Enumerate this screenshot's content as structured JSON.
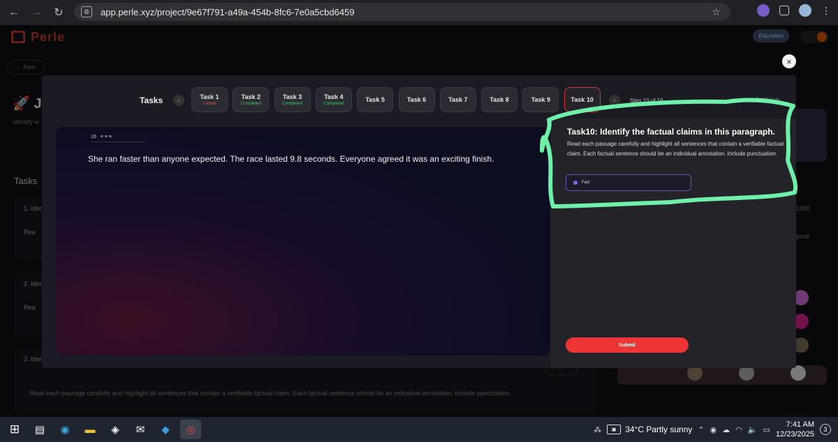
{
  "browser": {
    "url": "app.perle.xyz/project/9e67f791-a49a-454b-8fc6-7e0a5cbd6459",
    "icons": [
      "back-arrow-icon",
      "forward-arrow-icon",
      "reload-icon",
      "site-settings-icon",
      "star-icon",
      "extensions-icon",
      "profile-icon",
      "more-icon"
    ]
  },
  "app": {
    "logo": "Perle",
    "badge": "Education",
    "back_label": "Back",
    "title_partial": "Je",
    "subtitle_partial": "Identify w",
    "tasks_heading": "Tasks",
    "bg_cards": [
      {
        "label": "1. Iden",
        "sub": "Rea"
      },
      {
        "label": "2. Iden",
        "sub": "Rea"
      },
      {
        "label": "3. Iden"
      }
    ],
    "bg_card_text": "Read each passage carefully and highlight all sentences that contain a verifiable factual claim. Each factual sentence should be an individual annotation. Include punctuation.",
    "bg_card_button": "Completed",
    "bg_right_numbers": [
      "1000",
      "yone"
    ]
  },
  "modal": {
    "tasks_label": "Tasks",
    "tasks": [
      {
        "label": "Task 1",
        "status": "Locked",
        "status_color": "#e05555"
      },
      {
        "label": "Task 2",
        "status": "Completed",
        "status_color": "#3cc46a"
      },
      {
        "label": "Task 3",
        "status": "Completed",
        "status_color": "#3cc46a"
      },
      {
        "label": "Task 4",
        "status": "Completed",
        "status_color": "#3cc46a"
      },
      {
        "label": "Task 5",
        "status": ""
      },
      {
        "label": "Task 6",
        "status": ""
      },
      {
        "label": "Task 7",
        "status": ""
      },
      {
        "label": "Task 8",
        "status": ""
      },
      {
        "label": "Task 9",
        "status": ""
      },
      {
        "label": "Task 10",
        "status": "",
        "active": true
      }
    ],
    "step_text": "Step 10 of 10",
    "support_text": "Report issue",
    "toolbar": {
      "font_size": "16",
      "align_icons": "≡ ≡ ≡"
    },
    "passage": "She ran faster than anyone expected. The race lasted 9.8 seconds. Everyone agreed it was an exciting finish.",
    "instruction_title": "Task10: Identify the factual claims in this paragraph.",
    "instruction_desc": "Read each passage carefully and highlight all sentences that contain a verifiable factual claim. Each factual sentence should be an individual annotation. Include punctuation.",
    "label_option": "Fact",
    "submit_label": "Submit"
  },
  "highlight_color": "#6ff0a8",
  "accent_red": "#ee3535",
  "taskbar": {
    "weather": "34°C  Partly sunny",
    "time": "7:41 AM",
    "date": "12/23/2025",
    "notifications": "3"
  }
}
